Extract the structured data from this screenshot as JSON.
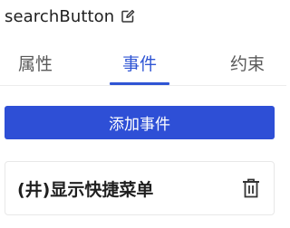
{
  "header": {
    "title": "searchButton",
    "edit_icon": "edit-icon"
  },
  "tabs": [
    {
      "label": "属性",
      "active": false
    },
    {
      "label": "事件",
      "active": true
    },
    {
      "label": "约束",
      "active": false
    }
  ],
  "colors": {
    "accent": "#2f55d4",
    "button": "#2e4fd6"
  },
  "actions": {
    "add_event_label": "添加事件"
  },
  "events": [
    {
      "label": "(井)显示快捷菜单",
      "icon": "trash-icon"
    }
  ]
}
